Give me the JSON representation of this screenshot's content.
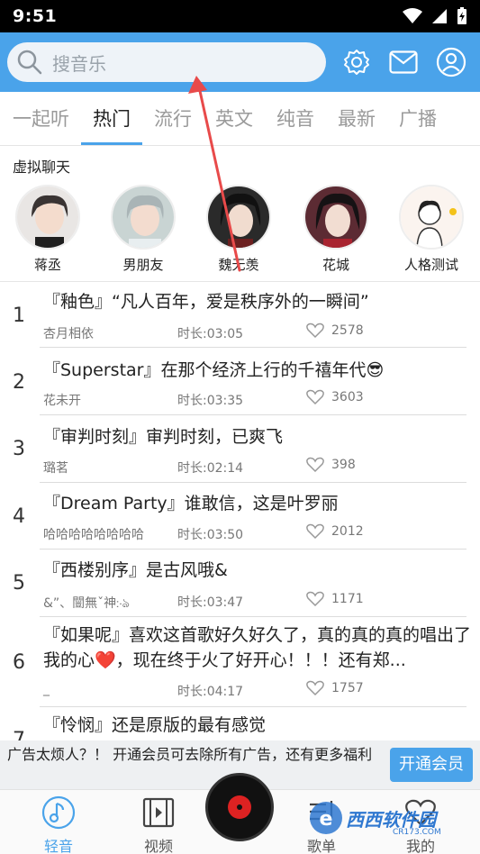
{
  "status_bar": {
    "time": "9:51"
  },
  "search": {
    "placeholder": "搜音乐"
  },
  "tabs": [
    {
      "label": "一起听"
    },
    {
      "label": "热门"
    },
    {
      "label": "流行"
    },
    {
      "label": "英文"
    },
    {
      "label": "纯音"
    },
    {
      "label": "最新"
    },
    {
      "label": "广播"
    }
  ],
  "section": {
    "title": "虚拟聊天"
  },
  "avatars": [
    {
      "name": "蒋丞"
    },
    {
      "name": "男朋友"
    },
    {
      "name": "魏无羡"
    },
    {
      "name": "花城"
    },
    {
      "name": "人格测试"
    }
  ],
  "songs": [
    {
      "rank": "1",
      "title": "『釉色』“凡人百年，爱是秩序外的一瞬间”",
      "author": "杏月相依",
      "duration": "时长:03:05",
      "likes": "2578"
    },
    {
      "rank": "2",
      "title": "『Superstar』在那个经济上行的千禧年代😎",
      "author": "花未开",
      "duration": "时长:03:35",
      "likes": "3603"
    },
    {
      "rank": "3",
      "title": "『审判时刻』审判时刻，已爽飞",
      "author": "璐茗",
      "duration": "时长:02:14",
      "likes": "398"
    },
    {
      "rank": "4",
      "title": "『Dream Party』谁敢信，这是叶罗丽",
      "author": "哈哈哈哈哈哈哈哈",
      "duration": "时长:03:50",
      "likes": "2012"
    },
    {
      "rank": "5",
      "title": "『西楼别序』是古风哦&",
      "author": "&”、闓無ˇ神჻ঌ",
      "duration": "时长:03:47",
      "likes": "1171"
    },
    {
      "rank": "6",
      "title": "『如果呢』喜欢这首歌好久好久了，真的真的真的唱出了我的心❤️，现在终于火了好开心！！！还有郑...",
      "author": "_",
      "duration": "时长:04:17",
      "likes": "1757"
    },
    {
      "rank": "7",
      "title": "『怜悯』还是原版的最有感觉"
    }
  ],
  "ad": {
    "text": "广告太烦人？！ 开通会员可去除所有广告，还有更多福利",
    "button": "开通会员"
  },
  "nav": [
    {
      "label": "轻音"
    },
    {
      "label": "视频"
    },
    {
      "label": "歌单"
    },
    {
      "label": "我的"
    }
  ],
  "watermark": {
    "text": "西西软件园",
    "sub": "CR173.COM"
  },
  "colors": {
    "accent": "#4aa3ea",
    "record_center": "#dd2222"
  }
}
